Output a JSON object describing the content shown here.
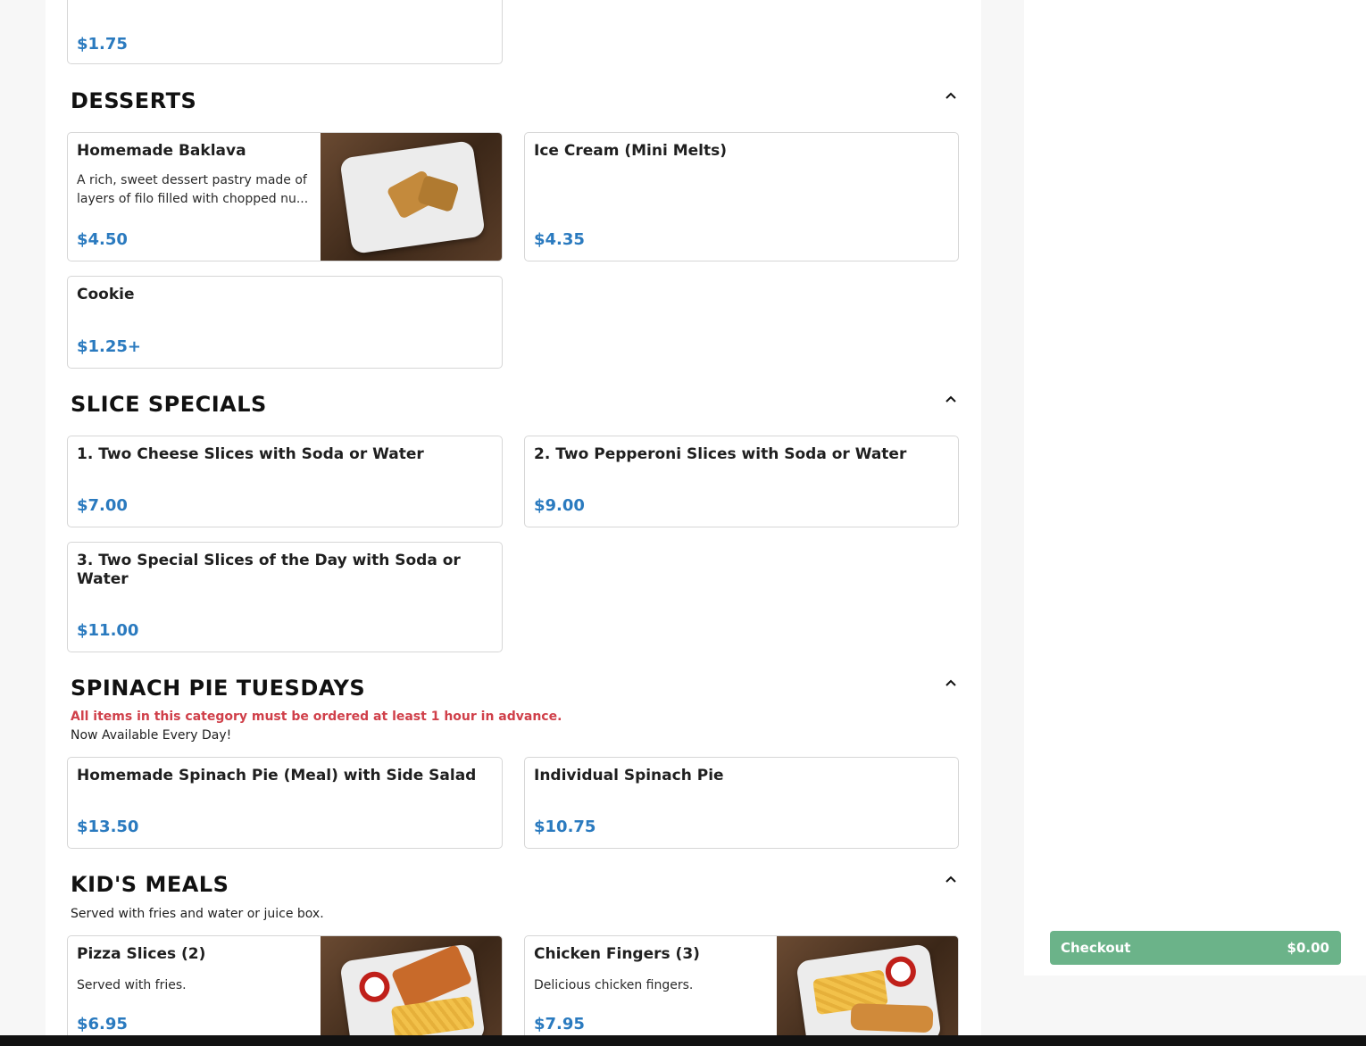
{
  "top_card": {
    "price": "$1.75"
  },
  "sections": {
    "desserts": {
      "title": "DESSERTS",
      "items": [
        {
          "name": "Homemade Baklava",
          "desc_line1": "A rich, sweet dessert pastry made of",
          "desc_line2": "layers of filo filled with chopped nu...",
          "price": "$4.50",
          "image": "baklava-photo"
        },
        {
          "name": "Ice Cream (Mini Melts)",
          "price": "$4.35"
        },
        {
          "name": "Cookie",
          "price": "$1.25+"
        }
      ]
    },
    "slice_specials": {
      "title": "SLICE SPECIALS",
      "items": [
        {
          "name": "1. Two Cheese Slices with Soda or Water",
          "price": "$7.00"
        },
        {
          "name": "2. Two Pepperoni Slices with Soda or Water",
          "price": "$9.00"
        },
        {
          "name_line1": "3. Two Special Slices of the Day with Soda or",
          "name_line2": "Water",
          "price": "$11.00"
        }
      ]
    },
    "spinach": {
      "title": "SPINACH PIE TUESDAYS",
      "notice": "All items in this category must be ordered at least 1 hour in advance.",
      "description": "Now Available Every Day!",
      "items": [
        {
          "name": "Homemade Spinach Pie (Meal) with Side Salad",
          "price": "$13.50"
        },
        {
          "name": "Individual Spinach Pie",
          "price": "$10.75"
        }
      ]
    },
    "kids": {
      "title": "KID'S MEALS",
      "description": "Served with fries and water or juice box.",
      "items": [
        {
          "name": "Pizza Slices (2)",
          "desc": "Served with fries.",
          "price": "$6.95",
          "image": "pizza-fries-photo"
        },
        {
          "name": "Chicken Fingers (3)",
          "desc": "Delicious chicken fingers.",
          "price": "$7.95",
          "image": "chicken-fries-photo"
        }
      ]
    }
  },
  "cart": {
    "checkout_label": "Checkout",
    "total": "$0.00"
  },
  "colors": {
    "price": "#2a7abf",
    "notice": "#d0404a",
    "checkout": "#6bb389"
  },
  "icons": {
    "collapse": "chevron-up-icon"
  }
}
